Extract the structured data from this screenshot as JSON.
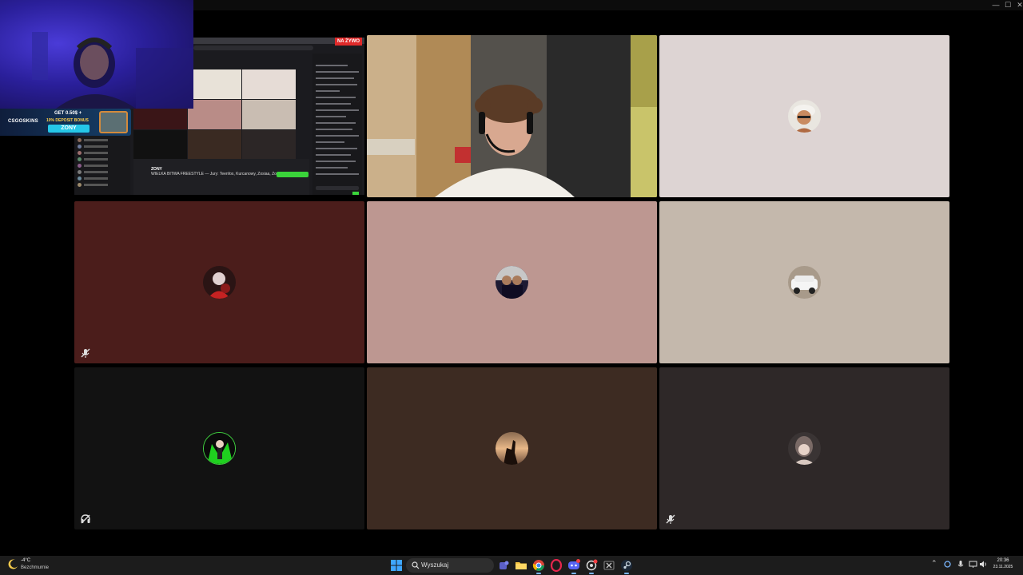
{
  "window": {
    "minimize_glyph": "—",
    "maximize_glyph": "☐",
    "close_glyph": "✕"
  },
  "overlay": {
    "stream_live_badge": "NA ŻYWO",
    "stream_channel_name": "ZONY",
    "stream_title": "WIELKA BITWA FREESTYLE — Jury: Teenfox, Kurcanowy, Zosiaa, Zony",
    "banner": {
      "logo": "CSGOSKINS",
      "line1": "GET 0.50$ +",
      "line2": "10% DEPOSIT BONUS",
      "code": "ZONY"
    }
  },
  "grid": {
    "tiles": [
      {
        "id": "stream-share",
        "kind": "screen-share",
        "muted": false
      },
      {
        "id": "camera-speaker",
        "kind": "camera",
        "speaking": true,
        "muted": false
      },
      {
        "id": "participant-3",
        "kind": "avatar",
        "bg": "#ddd4d3",
        "muted": false
      },
      {
        "id": "participant-4",
        "kind": "avatar",
        "bg": "#4b1d1b",
        "muted": true
      },
      {
        "id": "participant-5",
        "kind": "avatar",
        "bg": "#bd9791",
        "muted": false
      },
      {
        "id": "participant-6",
        "kind": "avatar",
        "bg": "#c4b8ac",
        "muted": false
      },
      {
        "id": "participant-7",
        "kind": "avatar",
        "bg": "#121212",
        "muted": true
      },
      {
        "id": "participant-8",
        "kind": "avatar",
        "bg": "#3d2b22",
        "muted": false
      },
      {
        "id": "participant-9",
        "kind": "avatar",
        "bg": "#2e2828",
        "muted": true
      }
    ]
  },
  "taskbar": {
    "weather_temp": "-4°C",
    "weather_condition": "Bezchmurnie",
    "search_placeholder": "Wyszukaj",
    "apps": [
      "teams-icon",
      "file-explorer-icon",
      "chrome-icon",
      "opera-gx-icon",
      "discord-icon",
      "chatgpt-icon",
      "excel-icon",
      "steam-icon"
    ],
    "clock_time": "20:36",
    "clock_date": "23.11.2025"
  },
  "colors": {
    "speaking_border": "#4bd26a",
    "taskbar_bg": "#1c1c1c"
  }
}
